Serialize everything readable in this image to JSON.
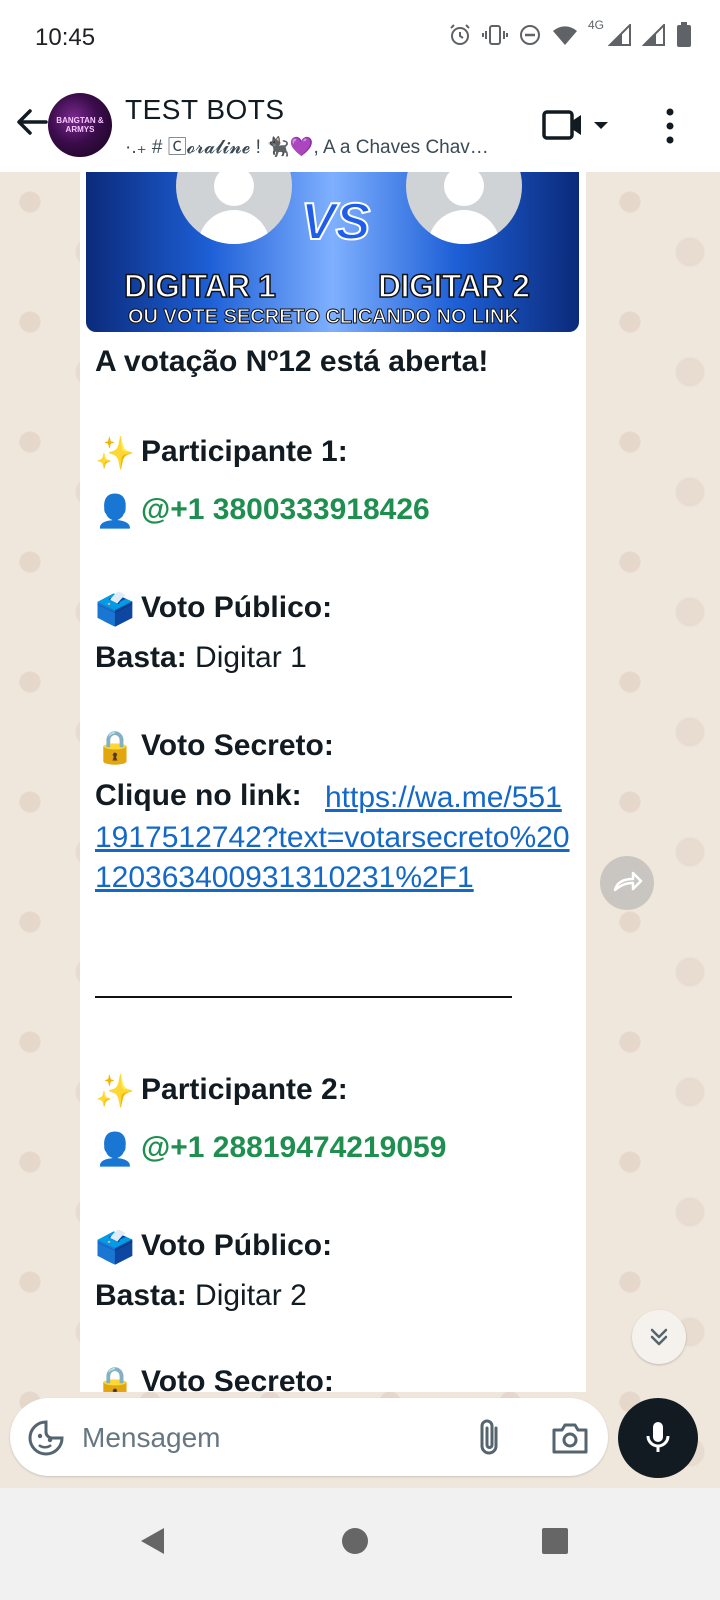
{
  "status_bar": {
    "time": "10:45",
    "network": "4G",
    "icons": [
      "alarm-icon",
      "vibrate-icon",
      "dnd-icon",
      "wifi-icon",
      "signal-icon",
      "battery-icon"
    ]
  },
  "header": {
    "title": "TEST BOTS",
    "subtitle": "·.₊ # 🄲𝓸𝓻𝓪𝓵𝓲𝓷𝓮 ! 🐈‍⬛💜, A a Chaves Chav…",
    "avatar_text": "BANGTAN & ARMYS"
  },
  "banner": {
    "vs": "VS",
    "left_label": "DIGITAR 1",
    "right_label": "DIGITAR 2",
    "bottom_label": "OU VOTE SECRETO CLICANDO NO LINK"
  },
  "message": {
    "heading": "A votação Nº12 está aberta!",
    "participant1_label": "Participante 1:",
    "participant1_number": "@+1 3800333918426",
    "public_vote_label": "Voto Público:",
    "basta_label": "Basta:",
    "basta1_value": " Digitar 1",
    "secret_vote_label": "Voto Secreto:",
    "click_label": "Clique no link:",
    "link1": "https://wa.me/5511917512742?text=votarsecreto%20120363400931310231%2F1",
    "participant2_label": "Participante 2:",
    "participant2_number": "@+1 28819474219059",
    "basta2_value": " Digitar 2",
    "secret_vote_label_2": "Voto Secreto:"
  },
  "emojis": {
    "sparkles": "✨",
    "person": "👤",
    "ballot": "🗳️",
    "lock": "🔒"
  },
  "input": {
    "placeholder": "Mensagem"
  },
  "colors": {
    "mention": "#1f8f4f",
    "link": "#1368c8",
    "mic_button": "#111b21"
  }
}
